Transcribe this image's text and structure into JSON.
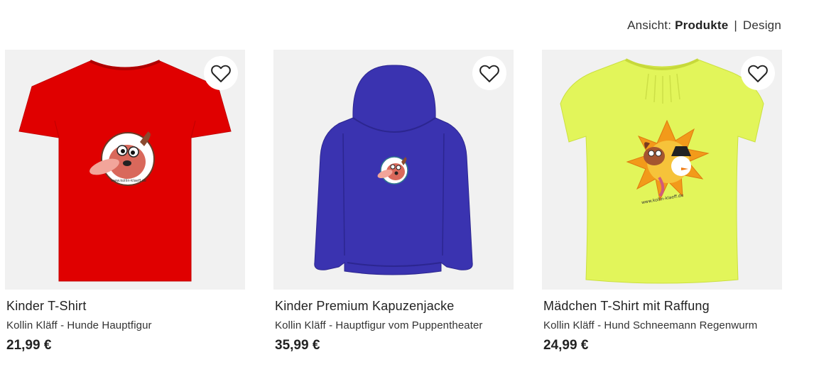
{
  "view_toggle": {
    "prefix": "Ansicht:",
    "active": "Produkte",
    "separator": "|",
    "other": "Design"
  },
  "products": [
    {
      "title": "Kinder T-Shirt",
      "subtitle": "Kollin Kläff - Hunde Hauptfigur",
      "price": "21,99 €",
      "color": "#e00000"
    },
    {
      "title": "Kinder Premium Kapuzenjacke",
      "subtitle": "Kollin Kläff - Hauptfigur vom Puppentheater",
      "price": "35,99 €",
      "color": "#3a33b0"
    },
    {
      "title": "Mädchen T-Shirt mit Raffung",
      "subtitle": "Kollin Kläff - Hund Schneemann Regenwurm",
      "price": "24,99 €",
      "color": "#e2f55a"
    }
  ],
  "icons": {
    "wishlist": "heart-icon"
  },
  "print_text": "www.kollin-klaeff.de"
}
